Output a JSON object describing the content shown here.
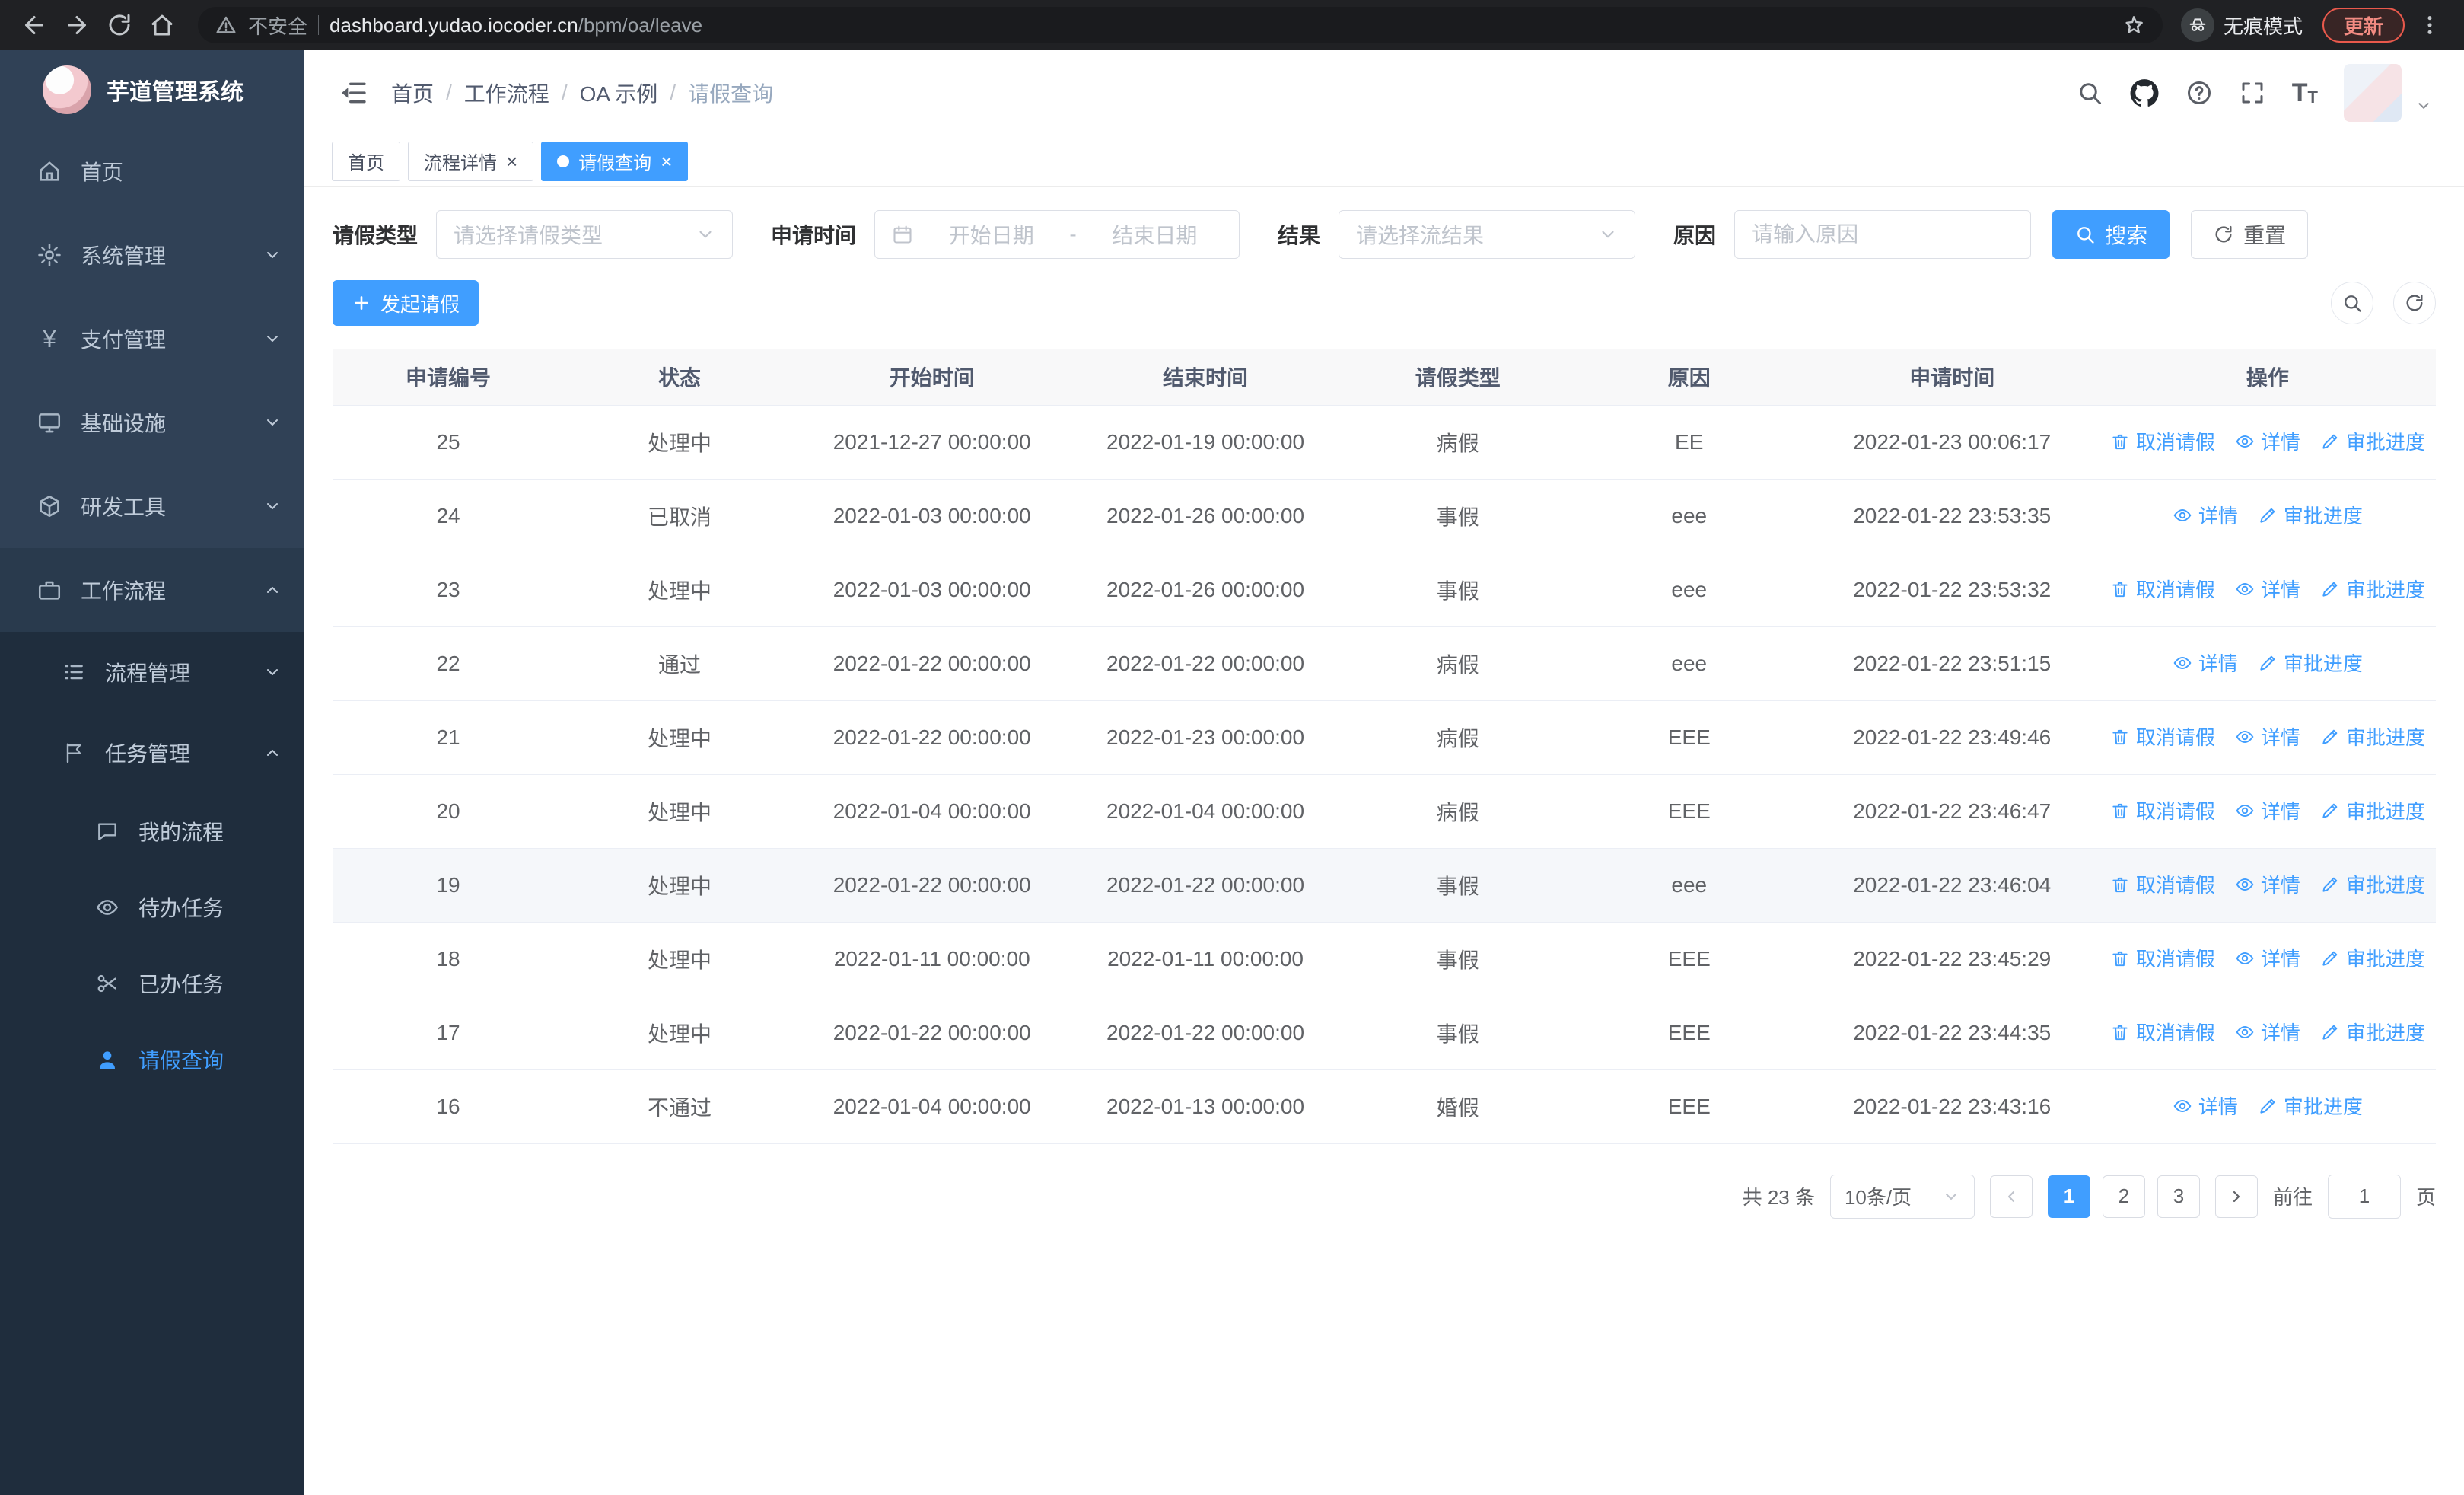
{
  "browser": {
    "security_label": "不安全",
    "url_host": "dashboard.yudao.iocoder.cn",
    "url_path": "/bpm/oa/leave",
    "incognito_label": "无痕模式",
    "update_label": "更新"
  },
  "app_title": "芋道管理系统",
  "sidebar": {
    "items": [
      {
        "label": "首页"
      },
      {
        "label": "系统管理"
      },
      {
        "label": "支付管理"
      },
      {
        "label": "基础设施"
      },
      {
        "label": "研发工具"
      },
      {
        "label": "工作流程"
      }
    ],
    "submenu": [
      {
        "label": "流程管理"
      },
      {
        "label": "任务管理"
      }
    ],
    "task_items": [
      {
        "label": "我的流程"
      },
      {
        "label": "待办任务"
      },
      {
        "label": "已办任务"
      },
      {
        "label": "请假查询"
      }
    ]
  },
  "breadcrumb": {
    "items": [
      "首页",
      "工作流程",
      "OA 示例",
      "请假查询"
    ]
  },
  "tabs": [
    {
      "label": "首页"
    },
    {
      "label": "流程详情"
    },
    {
      "label": "请假查询"
    }
  ],
  "filters": {
    "leave_type_label": "请假类型",
    "leave_type_placeholder": "请选择请假类型",
    "apply_time_label": "申请时间",
    "start_date_placeholder": "开始日期",
    "range_separator": "-",
    "end_date_placeholder": "结束日期",
    "result_label": "结果",
    "result_placeholder": "请选择流结果",
    "reason_label": "原因",
    "reason_placeholder": "请输入原因",
    "search_label": "搜索",
    "reset_label": "重置"
  },
  "toolbar": {
    "create_label": "发起请假"
  },
  "table": {
    "headers": [
      "申请编号",
      "状态",
      "开始时间",
      "结束时间",
      "请假类型",
      "原因",
      "申请时间",
      "操作"
    ],
    "action_labels": {
      "cancel": "取消请假",
      "detail": "详情",
      "progress": "审批进度"
    },
    "rows": [
      {
        "id": "25",
        "status": "处理中",
        "start": "2021-12-27 00:00:00",
        "end": "2022-01-19 00:00:00",
        "type": "病假",
        "reason": "EE",
        "applied": "2022-01-23 00:06:17",
        "actions": [
          "cancel",
          "detail",
          "progress"
        ]
      },
      {
        "id": "24",
        "status": "已取消",
        "start": "2022-01-03 00:00:00",
        "end": "2022-01-26 00:00:00",
        "type": "事假",
        "reason": "eee",
        "applied": "2022-01-22 23:53:35",
        "actions": [
          "detail",
          "progress"
        ]
      },
      {
        "id": "23",
        "status": "处理中",
        "start": "2022-01-03 00:00:00",
        "end": "2022-01-26 00:00:00",
        "type": "事假",
        "reason": "eee",
        "applied": "2022-01-22 23:53:32",
        "actions": [
          "cancel",
          "detail",
          "progress"
        ]
      },
      {
        "id": "22",
        "status": "通过",
        "start": "2022-01-22 00:00:00",
        "end": "2022-01-22 00:00:00",
        "type": "病假",
        "reason": "eee",
        "applied": "2022-01-22 23:51:15",
        "actions": [
          "detail",
          "progress"
        ]
      },
      {
        "id": "21",
        "status": "处理中",
        "start": "2022-01-22 00:00:00",
        "end": "2022-01-23 00:00:00",
        "type": "病假",
        "reason": "EEE",
        "applied": "2022-01-22 23:49:46",
        "actions": [
          "cancel",
          "detail",
          "progress"
        ]
      },
      {
        "id": "20",
        "status": "处理中",
        "start": "2022-01-04 00:00:00",
        "end": "2022-01-04 00:00:00",
        "type": "病假",
        "reason": "EEE",
        "applied": "2022-01-22 23:46:47",
        "actions": [
          "cancel",
          "detail",
          "progress"
        ]
      },
      {
        "id": "19",
        "status": "处理中",
        "start": "2022-01-22 00:00:00",
        "end": "2022-01-22 00:00:00",
        "type": "事假",
        "reason": "eee",
        "applied": "2022-01-22 23:46:04",
        "actions": [
          "cancel",
          "detail",
          "progress"
        ],
        "highlight": true
      },
      {
        "id": "18",
        "status": "处理中",
        "start": "2022-01-11 00:00:00",
        "end": "2022-01-11 00:00:00",
        "type": "事假",
        "reason": "EEE",
        "applied": "2022-01-22 23:45:29",
        "actions": [
          "cancel",
          "detail",
          "progress"
        ]
      },
      {
        "id": "17",
        "status": "处理中",
        "start": "2022-01-22 00:00:00",
        "end": "2022-01-22 00:00:00",
        "type": "事假",
        "reason": "EEE",
        "applied": "2022-01-22 23:44:35",
        "actions": [
          "cancel",
          "detail",
          "progress"
        ]
      },
      {
        "id": "16",
        "status": "不通过",
        "start": "2022-01-04 00:00:00",
        "end": "2022-01-13 00:00:00",
        "type": "婚假",
        "reason": "EEE",
        "applied": "2022-01-22 23:43:16",
        "actions": [
          "detail",
          "progress"
        ]
      }
    ]
  },
  "pagination": {
    "total_label": "共 23 条",
    "page_size_label": "10条/页",
    "pages": [
      "1",
      "2",
      "3"
    ],
    "active_page": "1",
    "goto_label": "前往",
    "goto_value": "1",
    "page_unit": "页"
  }
}
